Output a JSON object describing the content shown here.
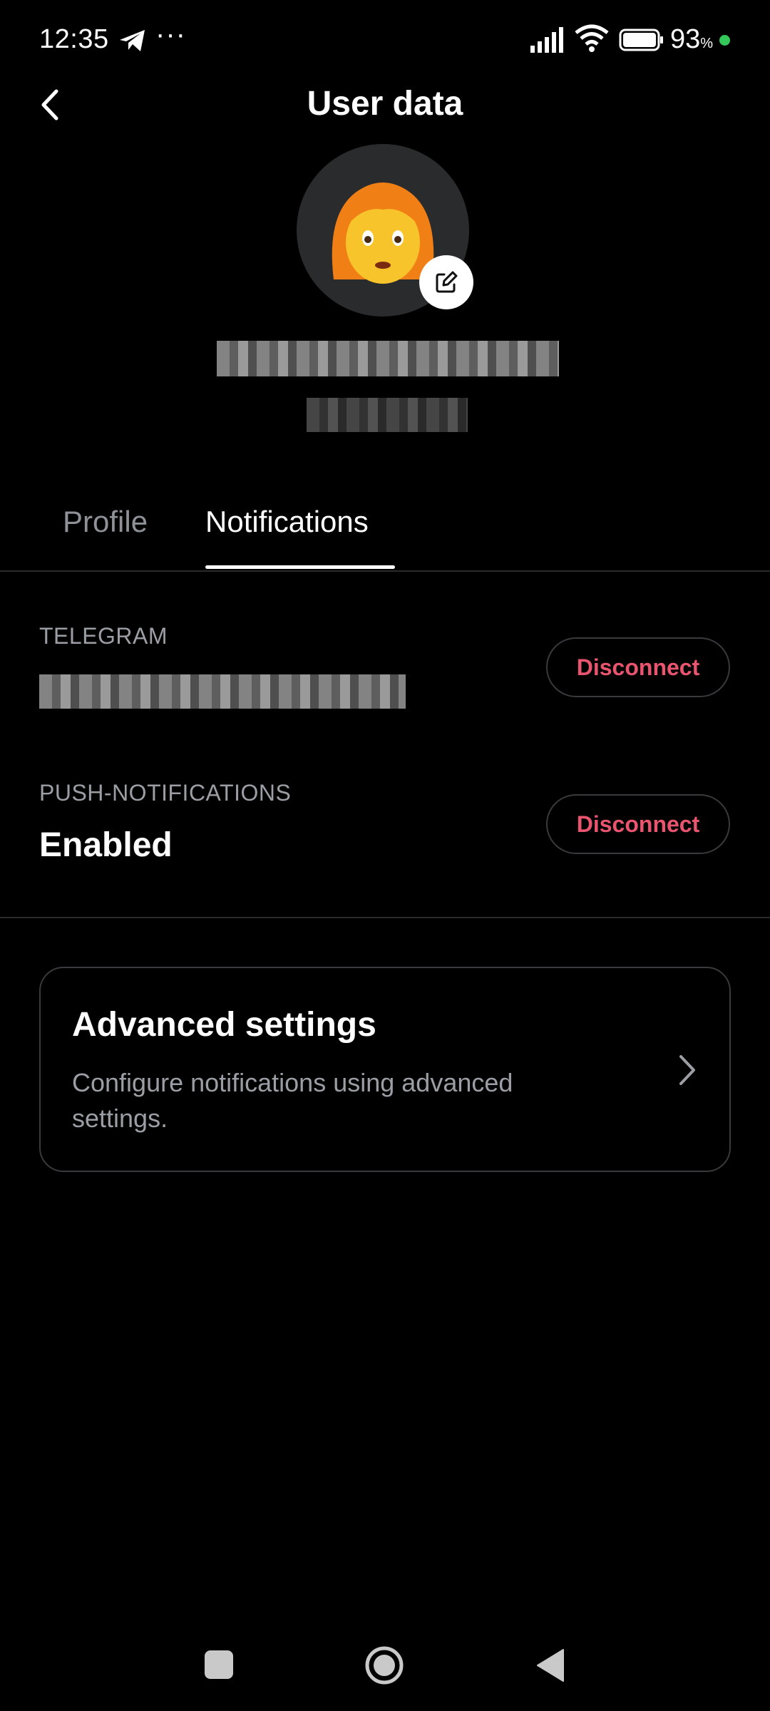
{
  "status_bar": {
    "time": "12:35",
    "more": "···",
    "battery_level": "93",
    "battery_unit": "%",
    "icons": [
      "telegram-icon",
      "signal-icon",
      "wifi-icon",
      "battery-icon"
    ]
  },
  "header": {
    "title": "User data",
    "back_icon": "chevron-left-icon"
  },
  "avatar": {
    "emoji": "👩",
    "edit_icon": "edit-icon"
  },
  "tabs": [
    {
      "label": "Profile",
      "active": false
    },
    {
      "label": "Notifications",
      "active": true
    }
  ],
  "telegram": {
    "label": "TELEGRAM",
    "button": "Disconnect"
  },
  "push": {
    "label": "PUSH-NOTIFICATIONS",
    "value": "Enabled",
    "button": "Disconnect"
  },
  "advanced": {
    "title": "Advanced settings",
    "description": "Configure notifications using advanced settings."
  },
  "colors": {
    "background": "#000000",
    "accent_red": "#e9546e",
    "muted": "#9b9ea4",
    "battery_dot": "#34c759"
  }
}
